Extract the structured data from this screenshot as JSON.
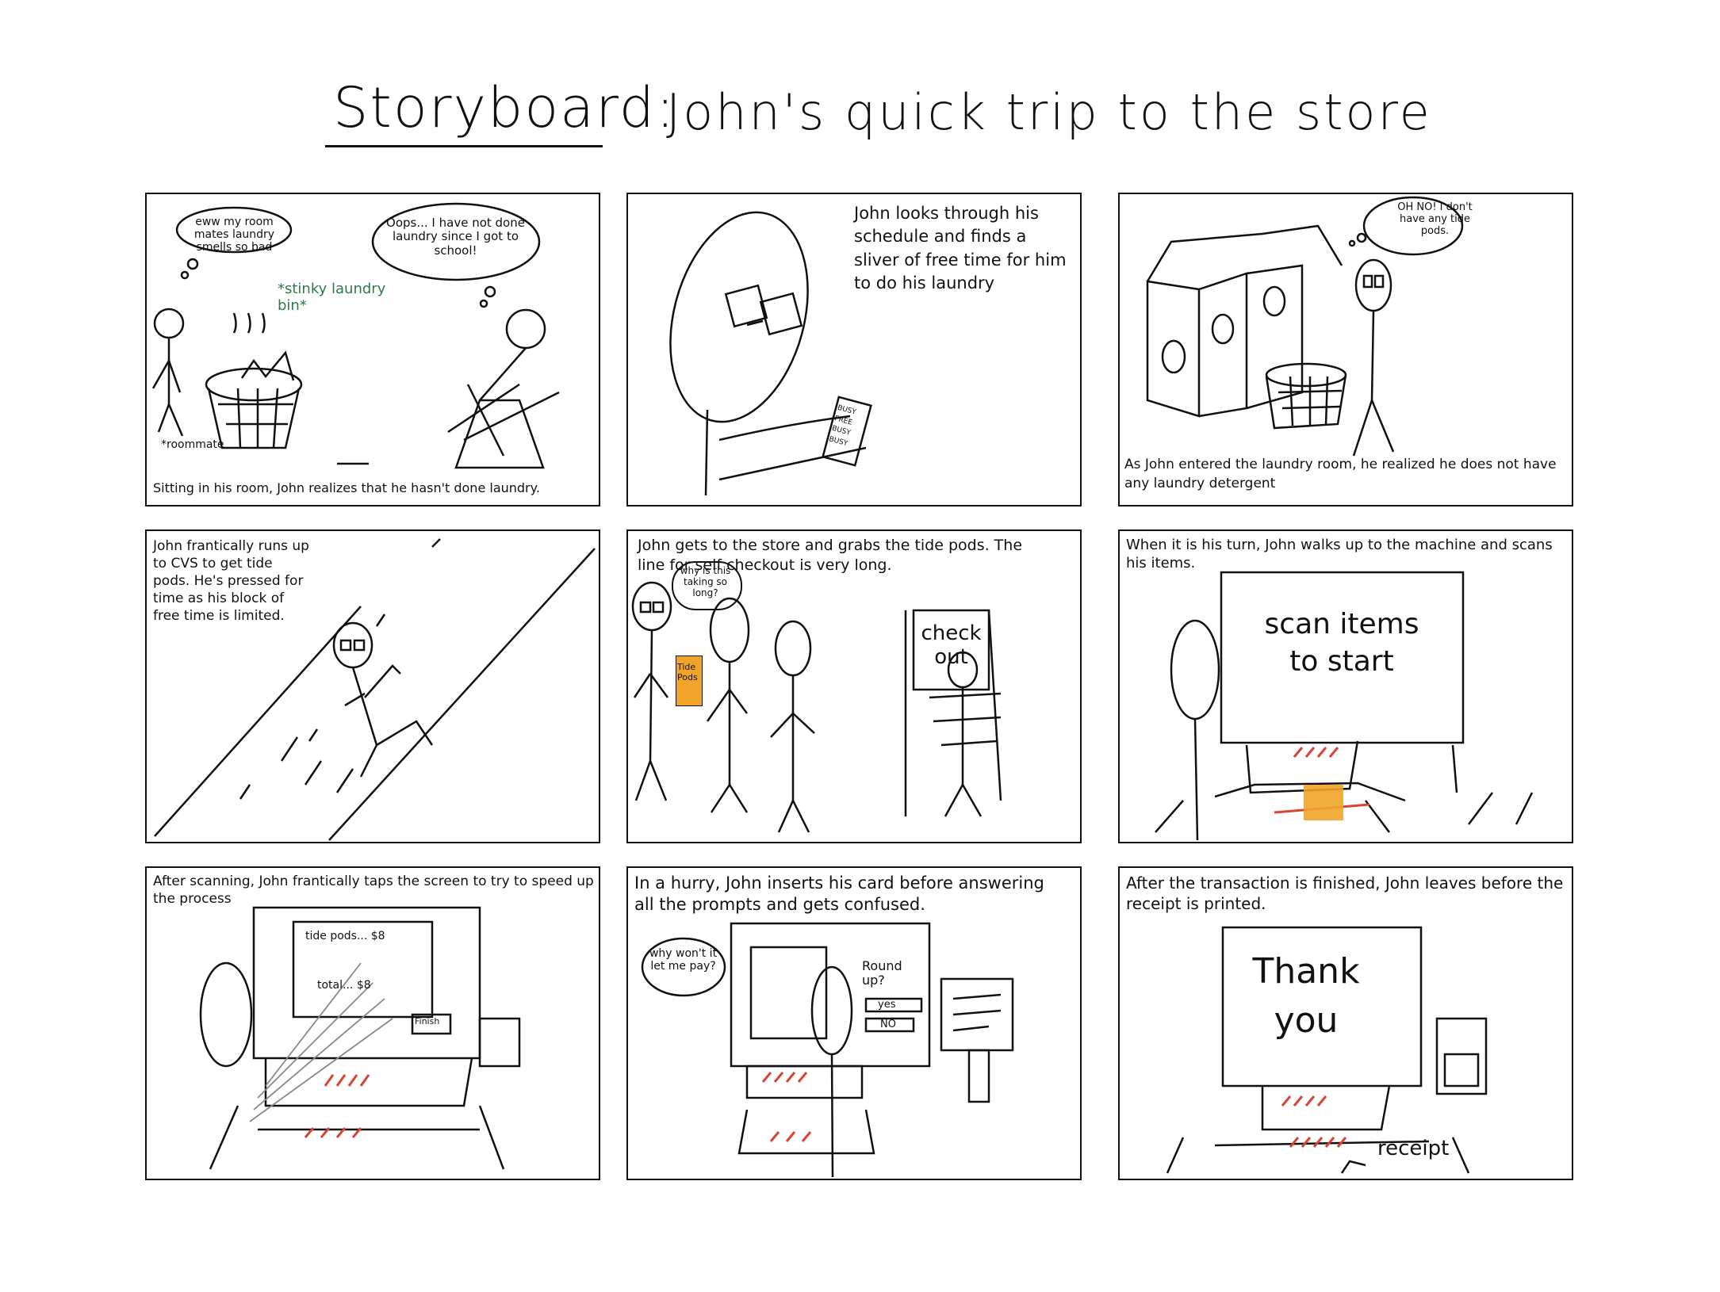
{
  "title": {
    "lead": "Storyboard:",
    "rest": "John's quick trip to the store"
  },
  "panels": {
    "p1": {
      "bubble_left": "eww my room mates laundry smells so bad",
      "bubble_right": "Oops... I have not done laundry since I got to school!",
      "green_note": "*stinky laundry bin*",
      "roommate_label": "*roommate",
      "caption": "Sitting in his room, John realizes that he hasn't done laundry."
    },
    "p2": {
      "caption": "John looks through his schedule and finds a sliver of free time for him to do his laundry",
      "phone_rows": [
        "BUSY",
        "FREE",
        "BUSY",
        "BUSY"
      ]
    },
    "p3": {
      "bubble": "OH NO! I don't have any tide pods.",
      "caption": "As John entered the laundry room, he realized he does not have any laundry detergent"
    },
    "p4": {
      "caption": "John frantically runs up to CVS to get tide pods. He's pressed for time as his block of free time is limited."
    },
    "p5": {
      "caption": "John gets to the store and grabs the tide pods. The line for self checkout is very long.",
      "bubble": "why is this taking so long?",
      "pods_label": "Tide Pods",
      "sign": "check out"
    },
    "p6": {
      "caption": "When it is his turn, John walks up to the machine and scans his items.",
      "screen": "scan items to start"
    },
    "p7": {
      "caption": "After scanning, John frantically taps the screen to try to speed up the process",
      "line1": "tide pods... $8",
      "line2": "total... $8",
      "finish": "Finish"
    },
    "p8": {
      "caption": "In a hurry, John inserts his card before answering all the prompts and gets confused.",
      "bubble": "why won't it let me pay?",
      "prompt": "Round up?",
      "yes": "yes",
      "no": "NO"
    },
    "p9": {
      "caption": "After the transaction is finished, John leaves before the receipt is printed.",
      "screen": "Thank you",
      "receipt": "receipt"
    }
  },
  "colors": {
    "ink": "#111111",
    "green": "#2f7a4a",
    "red": "#d64533",
    "orange": "#f0a52a"
  }
}
